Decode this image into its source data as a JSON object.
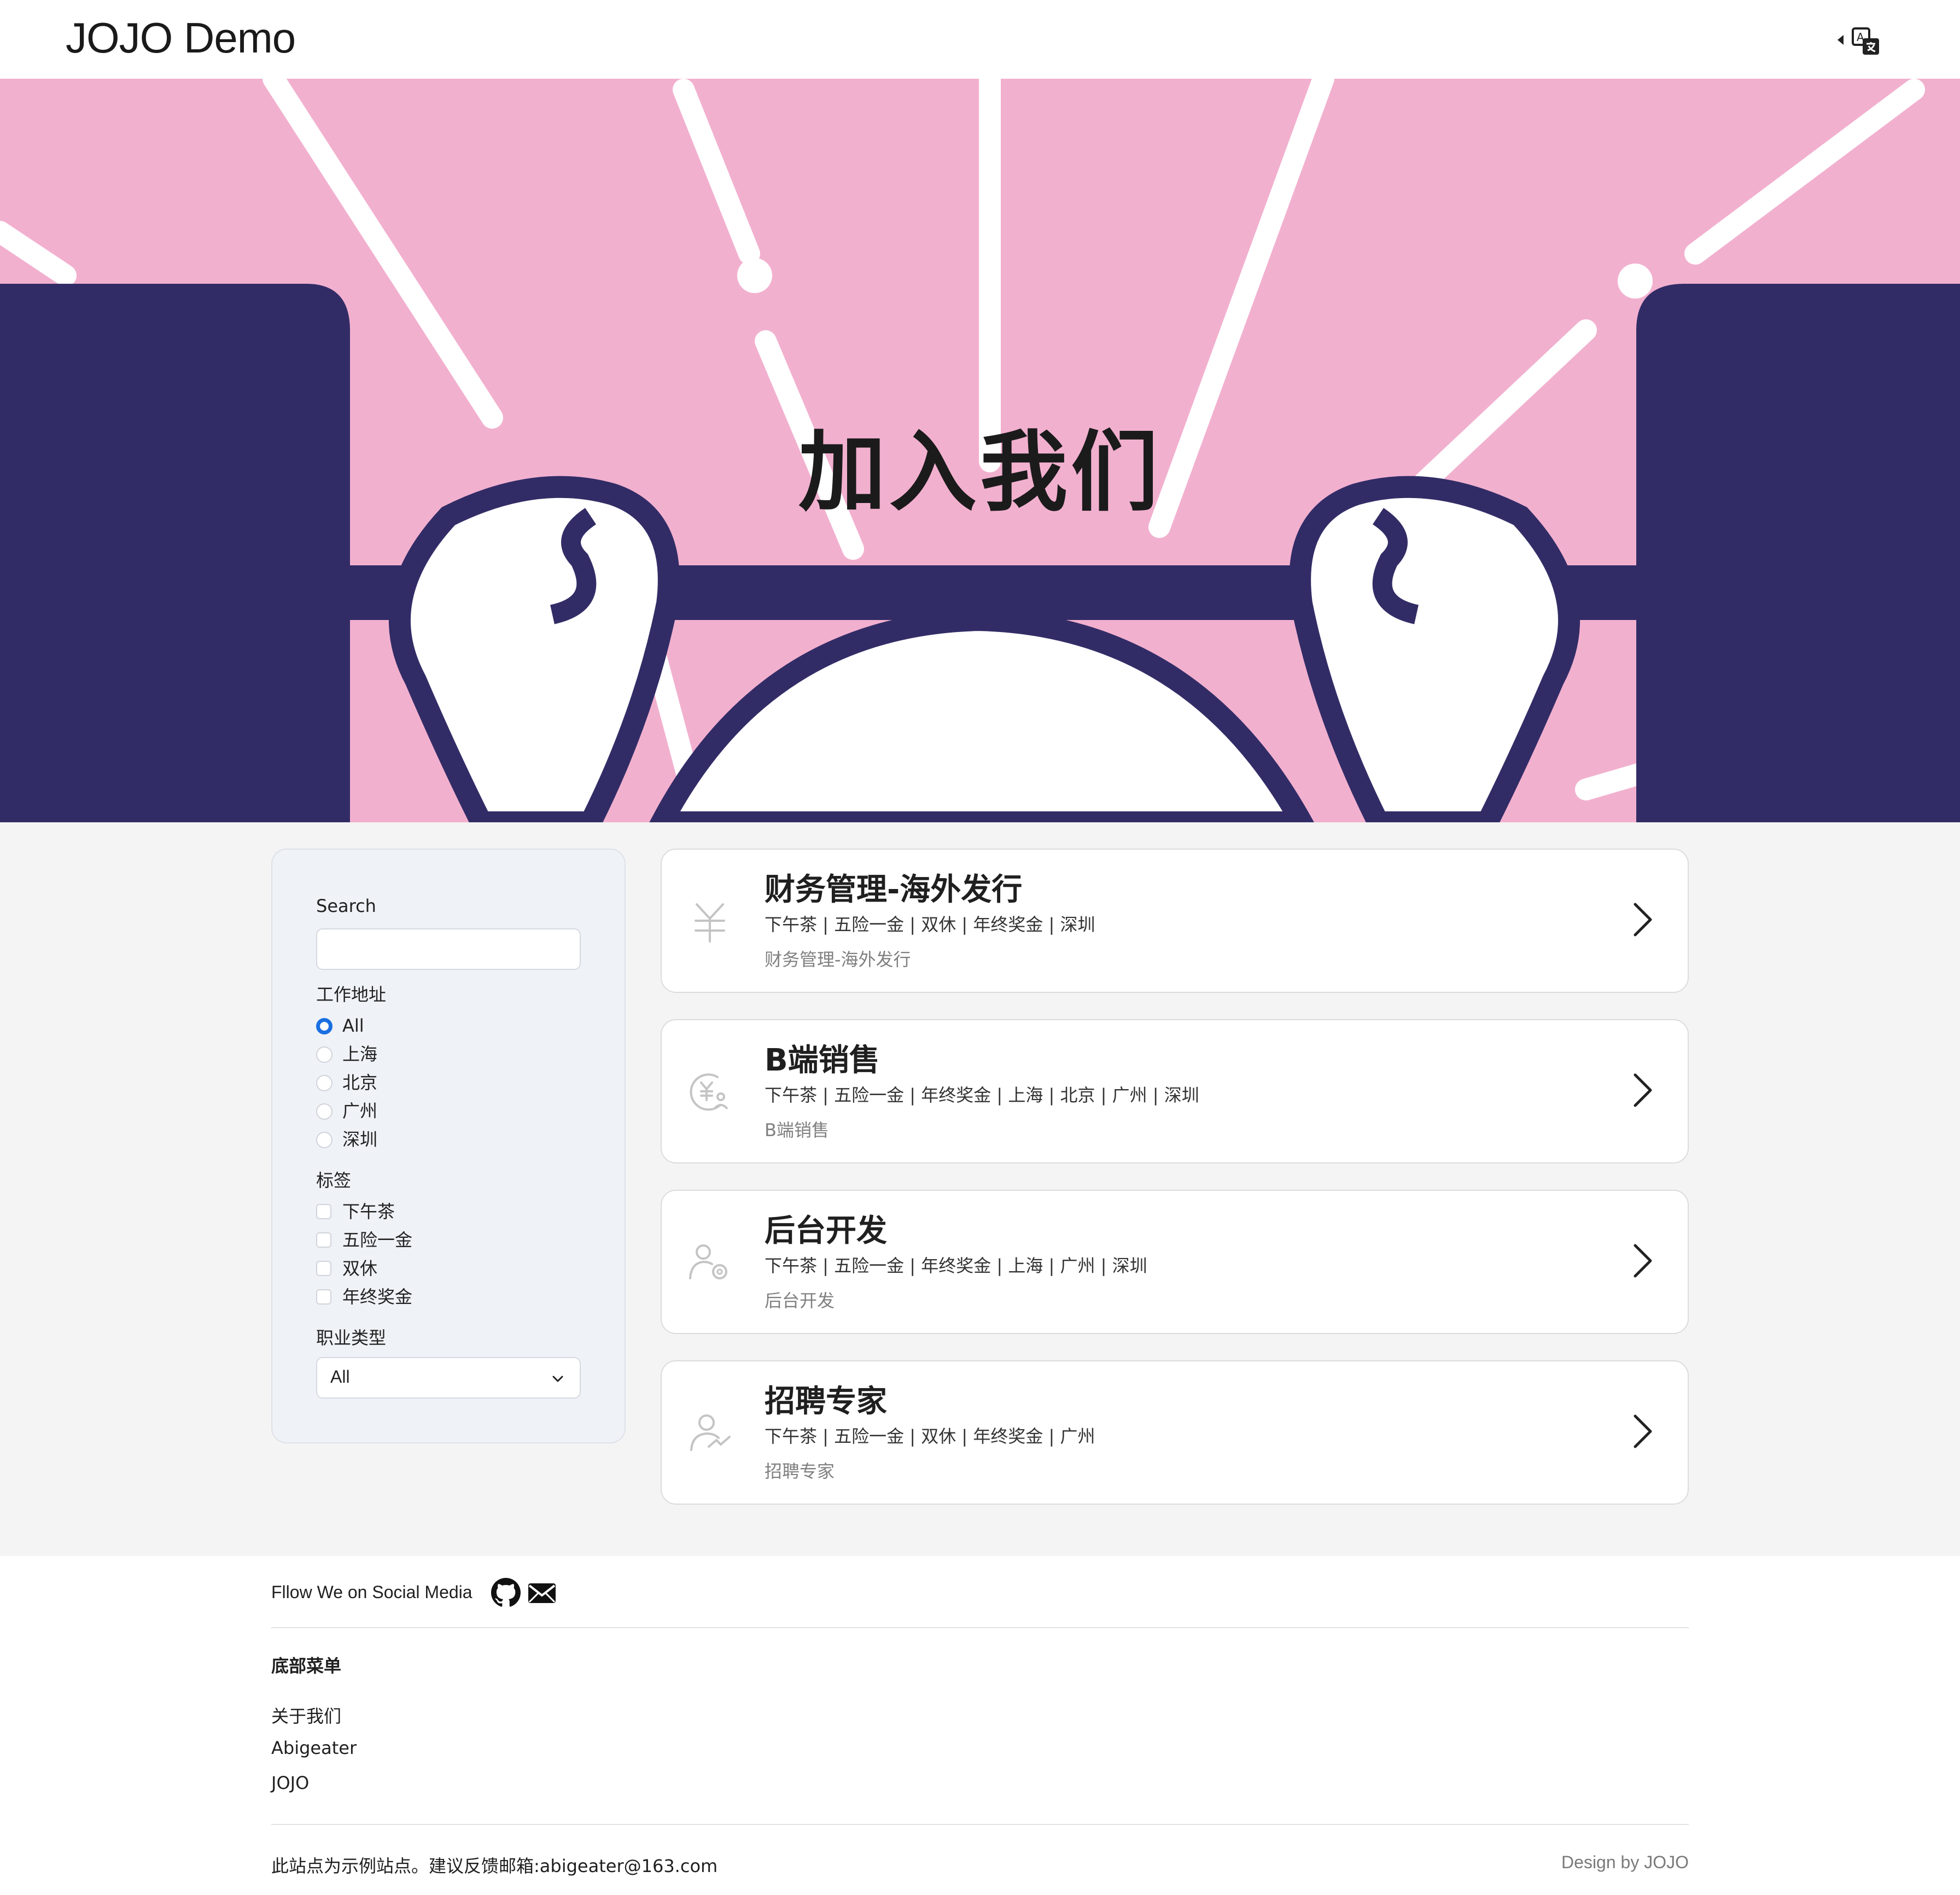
{
  "header": {
    "brand": "JOJO Demo",
    "language_icon": "translate-icon"
  },
  "hero": {
    "title": "加入我们"
  },
  "filters": {
    "search_label": "Search",
    "search_placeholder": "",
    "location_label": "工作地址",
    "locations": [
      "All",
      "上海",
      "北京",
      "广州",
      "深圳"
    ],
    "location_selected": "All",
    "tags_label": "标签",
    "tags": [
      "下午茶",
      "五险一金",
      "双休",
      "年终奖金"
    ],
    "job_type_label": "职业类型",
    "job_type_selected": "All"
  },
  "jobs": [
    {
      "title": "财务管理-海外发行",
      "tags": "下午茶 | 五险一金 | 双休 | 年终奖金 | 深圳",
      "subtitle": "财务管理-海外发行",
      "icon": "yuan-icon"
    },
    {
      "title": "B端销售",
      "tags": "下午茶 | 五险一金 | 年终奖金 | 上海 | 北京 | 广州 | 深圳",
      "subtitle": "B端销售",
      "icon": "sales-icon"
    },
    {
      "title": "后台开发",
      "tags": "下午茶 | 五险一金 | 年终奖金 | 上海 | 广州 | 深圳",
      "subtitle": "后台开发",
      "icon": "user-settings-icon"
    },
    {
      "title": "招聘专家",
      "tags": "下午茶 | 五险一金 | 双休 | 年终奖金 | 广州",
      "subtitle": "招聘专家",
      "icon": "recruit-icon"
    }
  ],
  "footer": {
    "social_label": "Fllow We on Social Media",
    "social_icons": [
      "github-icon",
      "mail-icon"
    ],
    "menu_title": "底部菜单",
    "menu_links": [
      "关于我们",
      "Abigeater",
      "JOJO"
    ],
    "copyright": "此站点为示例站点。建议反馈邮箱:abigeater@163.com",
    "design_credit": "Design by JOJO"
  }
}
